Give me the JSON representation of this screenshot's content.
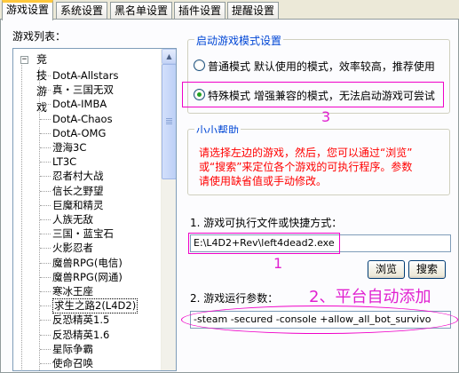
{
  "tabs": [
    {
      "label": "游戏设置",
      "active": true
    },
    {
      "label": "系统设置",
      "active": false
    },
    {
      "label": "黑名单设置",
      "active": false
    },
    {
      "label": "插件设置",
      "active": false
    },
    {
      "label": "提醒设置",
      "active": false
    }
  ],
  "game_list": {
    "label": "游戏列表：",
    "root": {
      "label": "竞技游戏",
      "expander": "−"
    },
    "items": [
      "DotA-Allstars",
      "真・三国无双",
      "DotA-IMBA",
      "DotA-Chaos",
      "DotA-OMG",
      "澄海3C",
      "LT3C",
      "忍者村大战",
      "信长之野望",
      "巨魔和精灵",
      "人族无敌",
      "三国・蓝宝石",
      "火影忍者",
      "魔兽RPG(电信)",
      "魔兽RPG(网通)",
      "寒冰王座",
      "求生之路2(L4D2)",
      "反恐精英1.5",
      "反恐精英1.6",
      "星际争霸",
      "使命召唤"
    ],
    "selected_index": 16
  },
  "launch_mode": {
    "title": "启动游戏模式设置",
    "normal": {
      "label": "普通模式  默认使用的模式，效率较高，推荐使用",
      "checked": false
    },
    "special": {
      "label": "特殊模式  增强兼容的模式，无法启动游戏可尝试",
      "checked": true
    }
  },
  "help": {
    "title": "小小帮助",
    "lines": [
      "请选择左边的游戏，然后，您可以通过“浏览”",
      "或“搜索”来定位各个游戏的可执行程序。参数",
      "请使用缺省值或手动修改。"
    ]
  },
  "exe": {
    "label": "1. 游戏可执行文件或快捷方式：",
    "value": "E:\\L4D2+Rev\\left4dead2.exe",
    "browse_label": "浏览",
    "search_label": "搜索"
  },
  "params": {
    "label": "2. 游戏运行参数：",
    "value": "-steam -secured -console +allow_all_bot_survivo"
  },
  "annotations": {
    "one": "1",
    "two": "2、平台自动添加",
    "three": "3"
  },
  "colors": {
    "tab_accent": "#ffc83c",
    "group_title": "#0046d5",
    "help_text": "#ff0000",
    "annotation": "#e020d0"
  }
}
